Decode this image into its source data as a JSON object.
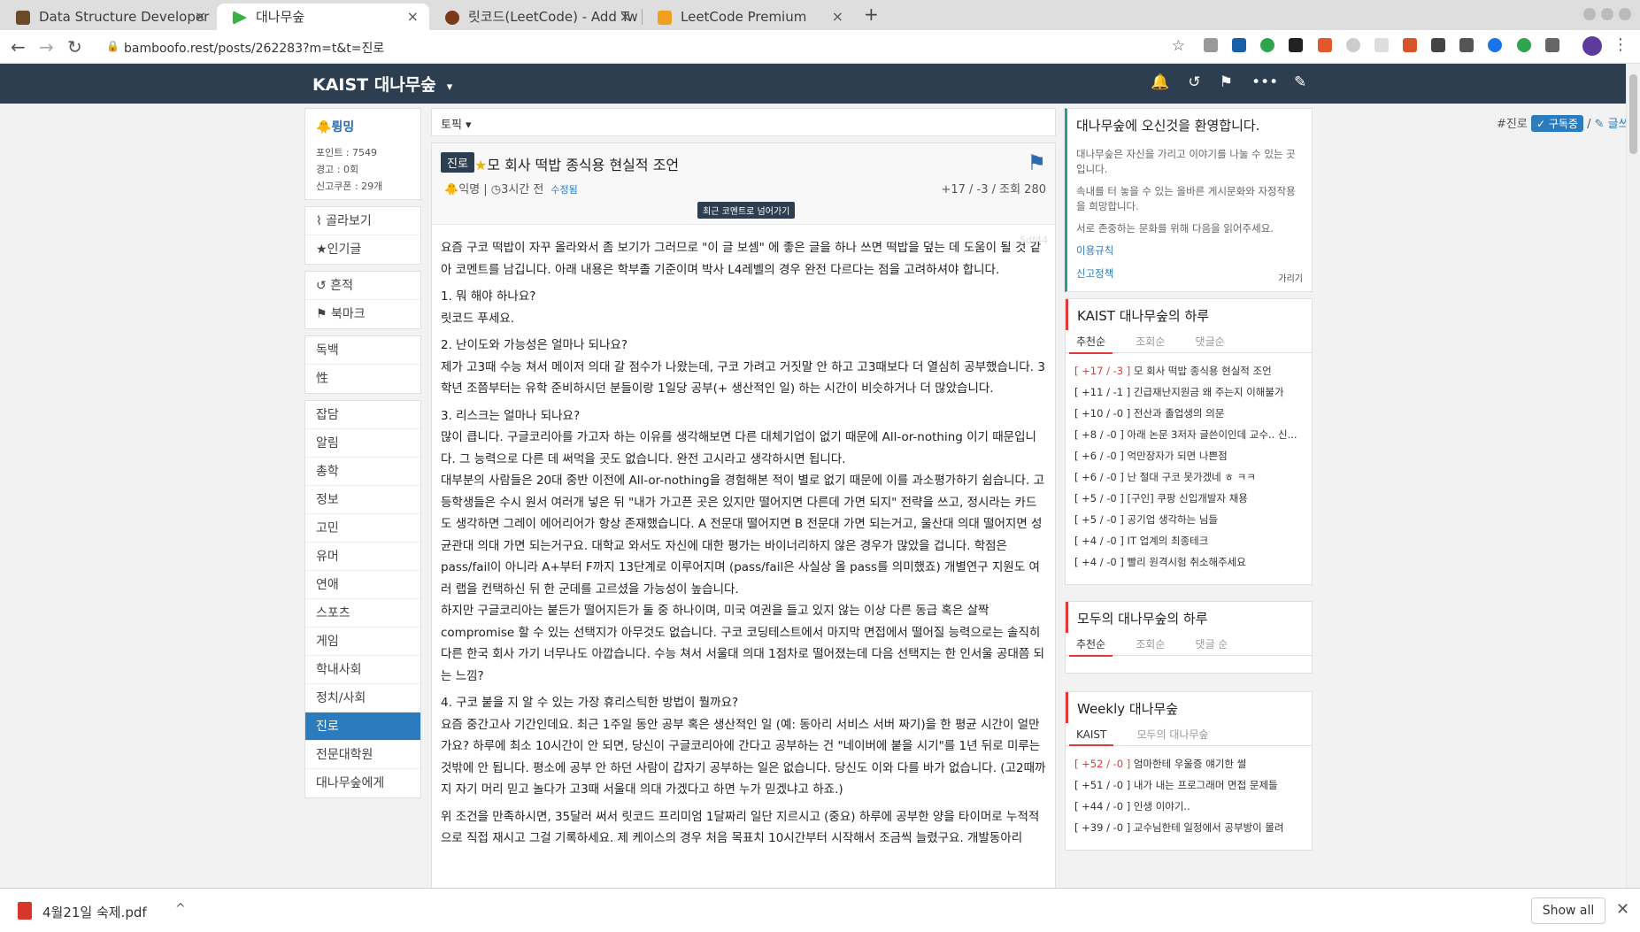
{
  "browser": {
    "tabs": [
      {
        "title": "Data Structure Developer",
        "icon_color": "#6b4a2a"
      },
      {
        "title": "대나무숲",
        "icon_color": "#3cb043"
      },
      {
        "title": "릿코드(LeetCode) - Add Tw",
        "icon_color": "#7a3a1a"
      },
      {
        "title": "LeetCode Premium",
        "icon_color": "#f0a020"
      }
    ],
    "new_tab": "+",
    "url": "bamboofo.rest/posts/262283?m=t&t=진로"
  },
  "site": {
    "title": "KAIST 대나무숲",
    "caret": "▾",
    "icons": [
      "bell-icon",
      "history-icon",
      "bookmark-icon",
      "more-icon"
    ],
    "write_icon": "pencil-icon"
  },
  "user": {
    "name": "륑밍",
    "points": "포인트 : 7549",
    "warnings": "경고 : 0회",
    "report_coupons": "신고쿠폰 : 29개"
  },
  "menu_groups": [
    [
      {
        "label": "골라보기",
        "icon": "rss-icon"
      },
      {
        "label": "인기글",
        "icon": "star-icon"
      }
    ],
    [
      {
        "label": "흔적",
        "icon": "history-icon"
      },
      {
        "label": "북마크",
        "icon": "bookmark-icon"
      }
    ],
    [
      {
        "label": "독백"
      },
      {
        "label": "性"
      }
    ],
    [
      {
        "label": "잡담"
      },
      {
        "label": "알림"
      },
      {
        "label": "총학"
      },
      {
        "label": "정보"
      },
      {
        "label": "고민"
      },
      {
        "label": "유머"
      },
      {
        "label": "연애"
      },
      {
        "label": "스포츠"
      },
      {
        "label": "게임"
      },
      {
        "label": "학내사회"
      },
      {
        "label": "정치/사회"
      },
      {
        "label": "진로",
        "selected": true
      },
      {
        "label": "전문대학원"
      },
      {
        "label": "대나무숲에게"
      }
    ]
  ],
  "topic": {
    "label": "토픽 ▾",
    "hashtag": "#진로",
    "subscribe": "✓ 구독중",
    "sep": "/",
    "write": "✎ 글쓰기"
  },
  "post": {
    "tag": "진로",
    "title": "모 회사 떡밥 종식용 현실적 조언",
    "author": "익명",
    "time": "3시간 전",
    "edited": "수정됨",
    "stats": "+17 / -3 / 조회 280",
    "jump": "최근 코멘트로 넘어가기",
    "hash": "5df44",
    "paragraphs": [
      "요즘 구코 떡밥이 자꾸 올라와서 좀 보기가 그러므로 \"이 글 보셈\" 에 좋은 글을 하나 쓰면 떡밥을 덮는 데 도움이 될 것 같아 코멘트를 남깁니다. 아래 내용은 학부졸 기준이며 박사 L4레벨의 경우 완전 다르다는 점을 고려하셔야 합니다.",
      "1. 뭐 해야 하나요?\n릿코드 푸세요.",
      "2. 난이도와 가능성은 얼마나 되나요?\n제가 고3때 수능 쳐서 메이저 의대 갈 점수가 나왔는데, 구코 가려고 거짓말 안 하고 고3때보다 더 열심히 공부했습니다. 3학년 조쯤부터는 유학 준비하시던 분들이랑 1일당 공부(+ 생산적인 일) 하는 시간이 비슷하거나 더 많았습니다.",
      "3. 리스크는 얼마나 되나요?\n많이 큽니다. 구글코리아를 가고자 하는 이유를 생각해보면 다른 대체기업이 없기 때문에 All-or-nothing 이기 때문입니다. 그 능력으로 다른 데 써먹을 곳도 없습니다. 완전 고시라고 생각하시면 됩니다.\n대부분의 사람들은 20대 중반 이전에 All-or-nothing을 경험해본 적이 별로 없기 때문에 이를 과소평가하기 쉽습니다. 고등학생들은 수시 원서 여러개 넣은 뒤 \"내가 가고픈 곳은 있지만 떨어지면 다른데 가면 되지\" 전략을 쓰고, 정시라는 카드도 생각하면 그레이 에어리어가 항상 존재했습니다. A 전문대 떨어지면 B 전문대 가면 되는거고, 울산대 의대 떨어지면 성균관대 의대 가면 되는거구요. 대학교 와서도 자신에 대한 평가는 바이너리하지 않은 경우가 많았을 겁니다. 학점은 pass/fail이 아니라 A+부터 F까지 13단계로 이루어지며 (pass/fail은 사실상 올 pass를 의미했죠) 개별연구 지원도 여러 랩을 컨택하신 뒤 한 군데를 고르셨을 가능성이 높습니다.\n하지만 구글코리아는 붙든가 떨어지든가 둘 중 하나이며, 미국 여권을 들고 있지 않는 이상 다른 동급 혹은 살짝 compromise 할 수 있는 선택지가 아무것도 없습니다. 구코 코딩테스트에서 마지막 면접에서 떨어질 능력으로는 솔직히 다른 한국 회사 가기 너무나도 아깝습니다. 수능 쳐서 서울대 의대 1점차로 떨어졌는데 다음 선택지는 한 인서울 공대쯤 되는 느낌?",
      "4. 구코 붙을 지 알 수 있는 가장 휴리스틱한 방법이 뭘까요?\n요즘 중간고사 기간인데요. 최근 1주일 동안 공부 혹은 생산적인 일 (예: 동아리 서비스 서버 짜기)을 한 평균 시간이 얼만가요? 하루에 최소 10시간이 안 되면, 당신이 구글코리아에 간다고 공부하는 건 \"네이버에 붙을 시기\"를 1년 뒤로 미루는 것밖에 안 됩니다. 평소에 공부 안 하던 사람이 갑자기 공부하는 일은 없습니다. 당신도 이와 다를 바가 없습니다. (고2때까지 자기 머리 믿고 놀다가 고3때 서울대 의대 가겠다고 하면 누가 믿겠냐고 하죠.)",
      "위 조건을 만족하시면, 35달러 써서 릿코드 프리미엄 1달짜리 일단 지르시고 (중요) 하루에 공부한 양을 타이머로 누적적으로 직접 재시고 그걸 기록하세요. 제 케이스의 경우 처음 목표치 10시간부터 시작해서 조금씩 늘렸구요. 개발동아리"
    ]
  },
  "welcome": {
    "title": "대나무숲에 오신것을 환영합니다.",
    "texts": [
      "대나무숲은 자신을 가리고 이야기를 나눌 수 있는 곳입니다.",
      "속내를 터 놓을 수 있는 올바른 게시문화와 자정작용을 희망합니다.",
      "서로 존중하는 문화를 위해 다음을 읽어주세요."
    ],
    "links": [
      "이용규칙",
      "신고정책"
    ],
    "hide": "가리기"
  },
  "kaist_daily": {
    "title": "KAIST 대나무숲의 하루",
    "tabs": [
      "추천순",
      "조회순",
      "댓글순"
    ],
    "items": [
      {
        "score": "[ +17 / -3 ]",
        "text": "모 회사 떡밥 종식용 현실적 조언",
        "hot": true
      },
      {
        "score": "[ +11 / -1 ]",
        "text": "긴급재난지원금 왜 주는지 이해불가"
      },
      {
        "score": "[ +10 / -0 ]",
        "text": "전산과 졸업생의 의문"
      },
      {
        "score": "[ +8 / -0 ]",
        "text": "아래 논문 3저자 글쓴이인데 교수.. 신..."
      },
      {
        "score": "[ +6 / -0 ]",
        "text": "억만장자가 되면 나쁜점"
      },
      {
        "score": "[ +6 / -0 ]",
        "text": "난 절대 구코 못가겠네 ㅎ ㅋㅋ"
      },
      {
        "score": "[ +5 / -0 ]",
        "text": "[구인] 쿠팡 신입개발자 채용"
      },
      {
        "score": "[ +5 / -0 ]",
        "text": "공기업 생각하는 님들"
      },
      {
        "score": "[ +4 / -0 ]",
        "text": "IT 업계의 최종테크"
      },
      {
        "score": "[ +4 / -0 ]",
        "text": "빨리 원격시험 취소해주세요"
      }
    ]
  },
  "all_daily": {
    "title": "모두의 대나무숲의 하루",
    "tabs": [
      "추천순",
      "조회순",
      "댓글 순"
    ]
  },
  "weekly": {
    "title": "Weekly 대나무숲",
    "tabs": [
      "KAIST",
      "모두의 대나무숲"
    ],
    "items": [
      {
        "score": "[ +52 / -0 ]",
        "text": "엄마한테 우울증 얘기한 썰",
        "hot": true
      },
      {
        "score": "[ +51 / -0 ]",
        "text": "내가 내는 프로그래머 면접 문제들"
      },
      {
        "score": "[ +44 / -0 ]",
        "text": "인생 이야기.."
      },
      {
        "score": "[ +39 / -0 ]",
        "text": "교수님한테 일정에서 공부방이 몰려"
      }
    ]
  },
  "download": {
    "filename": "4월21일 숙제.pdf",
    "caret": "^",
    "show_all": "Show all",
    "close": "✕"
  }
}
